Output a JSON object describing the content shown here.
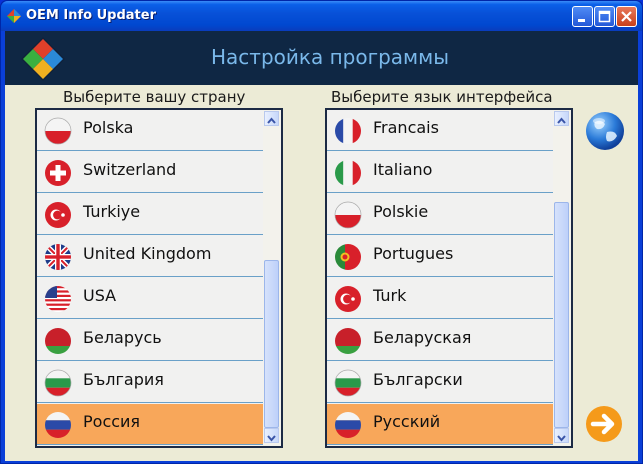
{
  "window": {
    "title": "OEM Info Updater",
    "controls": [
      "minimize",
      "maximize",
      "close"
    ]
  },
  "header": {
    "title": "Настройка программы"
  },
  "country": {
    "label": "Выберите вашу страну",
    "items": [
      {
        "label": "Polska",
        "icon": "poland-flag-icon"
      },
      {
        "label": "Switzerland",
        "icon": "switzerland-flag-icon"
      },
      {
        "label": "Turkiye",
        "icon": "turkey-flag-icon"
      },
      {
        "label": "United Kingdom",
        "icon": "uk-flag-icon"
      },
      {
        "label": "USA",
        "icon": "usa-flag-icon"
      },
      {
        "label": "Беларусь",
        "icon": "belarus-flag-icon"
      },
      {
        "label": "България",
        "icon": "bulgaria-flag-icon"
      },
      {
        "label": "Россия",
        "icon": "russia-flag-icon",
        "selected": true
      }
    ]
  },
  "language": {
    "label": "Выберите язык интерфейса",
    "items": [
      {
        "label": "Francais",
        "icon": "france-flag-icon"
      },
      {
        "label": "Italiano",
        "icon": "italy-flag-icon"
      },
      {
        "label": "Polskie",
        "icon": "poland-flag-icon"
      },
      {
        "label": "Portugues",
        "icon": "portugal-flag-icon"
      },
      {
        "label": "Turk",
        "icon": "turkey-flag-icon"
      },
      {
        "label": "Беларуская",
        "icon": "belarus-flag-icon"
      },
      {
        "label": "Български",
        "icon": "bulgaria-flag-icon"
      },
      {
        "label": "Русский",
        "icon": "russia-flag-icon",
        "selected": true
      }
    ]
  },
  "icons": {
    "globe": "globe-icon",
    "next": "next-arrow-icon",
    "logo": "app-logo-icon"
  },
  "colors": {
    "header_bg": "#0f2744",
    "header_text": "#7ab8ea",
    "selected": "#f8a75a",
    "next": "#f59a1a"
  }
}
